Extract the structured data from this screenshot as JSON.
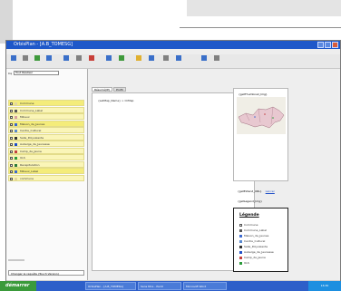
{
  "window": {
    "title": "OrbisPlan - [A.B_TOMESG]"
  },
  "sidebar": {
    "combo_label": "Cq",
    "combo_value": "Tout Réaliser",
    "layers": [
      {
        "label": "Commune"
      },
      {
        "label": "Commune_Label"
      },
      {
        "label": "Milieux"
      },
      {
        "label": "Maison_de_Jeunes"
      },
      {
        "label": "Centre_Culturel"
      },
      {
        "label": "Salle_Polyvalente"
      },
      {
        "label": "Auberge_de_Jeunesse"
      },
      {
        "label": "Camp_de_Jeune"
      },
      {
        "label": "ULS"
      },
      {
        "label": "Recapitulation"
      },
      {
        "label": "Milieux_Label"
      },
      {
        "label": "commune"
      }
    ],
    "button_label": "Changer la requête (Touch Version)"
  },
  "main": {
    "tabs": [
      {
        "label": "Résumé(IE)"
      },
      {
        "label": "Profil"
      }
    ],
    "doc_text": "{setMap_Name} > OrMap",
    "thumbnail_label": "{getThumbnail_Img}",
    "extent_label": "{getExtend_URL}",
    "extent_link": "Lancer",
    "legend_image_label": "{getLegend_Img}",
    "legend_title": "Légende",
    "legend_items": [
      {
        "label": "Commune",
        "color": "#ffffff"
      },
      {
        "label": "Commune_Label",
        "color": "#555555"
      },
      {
        "label": "Maison_de_Jeunes",
        "color": "#3d6ad0"
      },
      {
        "label": "Centre_Culturel",
        "color": "#5a8ad0"
      },
      {
        "label": "Salle_Polyvalente",
        "color": "#333333"
      },
      {
        "label": "Auberge_de_Jeunesse",
        "color": "#2050c8"
      },
      {
        "label": "Camp_de_Jeune",
        "color": "#c44040"
      },
      {
        "label": "ULS",
        "color": "#2a9a3a"
      }
    ]
  },
  "taskbar": {
    "start_label": "démarrer",
    "tasks": [
      {
        "label": "OrbisPlan - [A.B_TOMESG]"
      },
      {
        "label": "Sans titre - Paint"
      },
      {
        "label": "Microsoft Word"
      }
    ],
    "clock": "16:30"
  }
}
